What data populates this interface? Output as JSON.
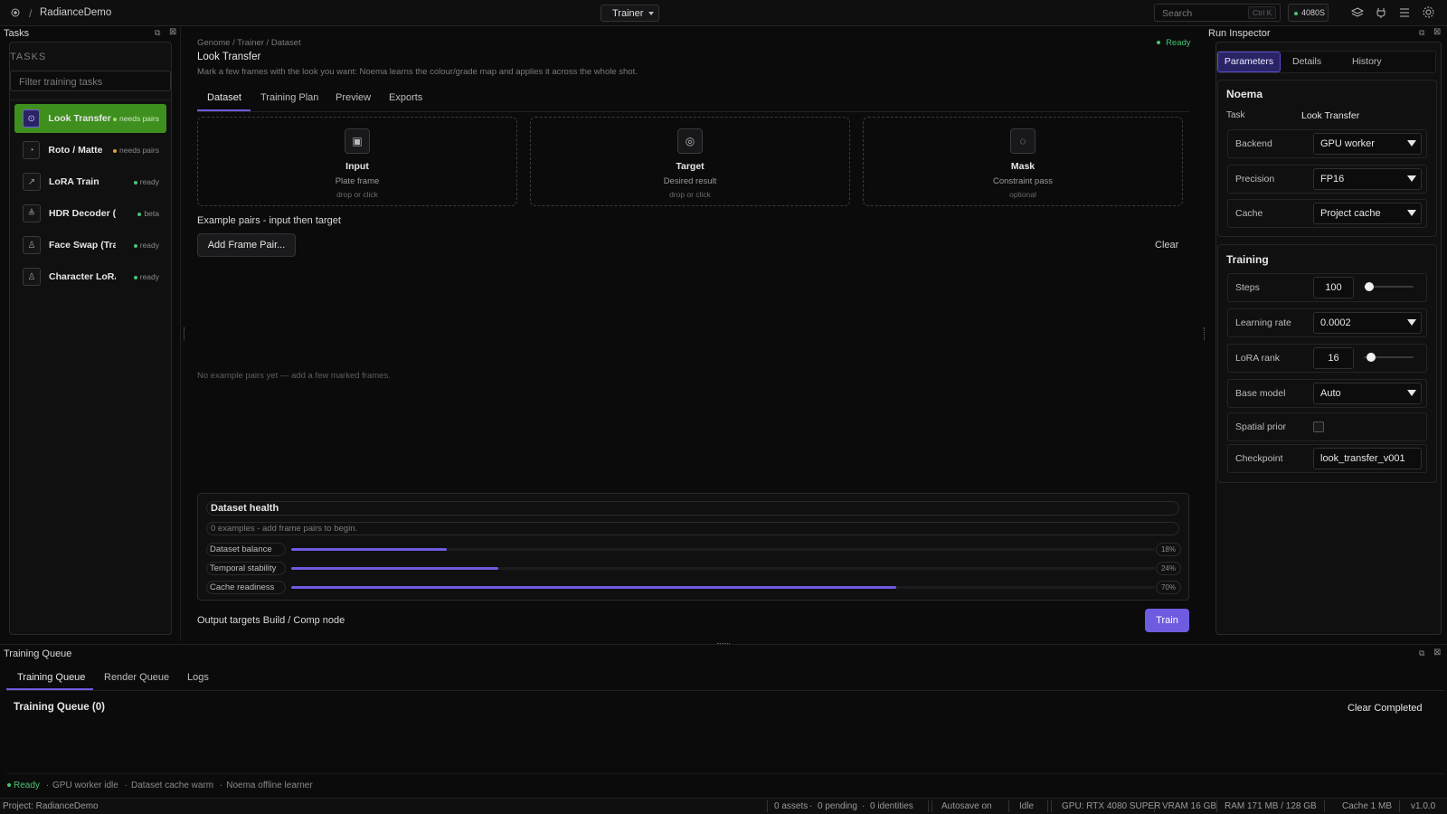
{
  "app": {
    "breadcrumb_sep": "/",
    "project_name": "RadianceDemo",
    "mode": "Trainer",
    "search_placeholder": "Search",
    "search_shortcut": "Ctrl K",
    "gpu_badge": "4080S"
  },
  "tasks_panel": {
    "title": "Tasks",
    "heading": "TASKS",
    "filter_placeholder": "Filter training tasks",
    "items": [
      {
        "label": "Look Transfer",
        "status": "needs pairs",
        "icon": "target-icon",
        "glyph": "⊙",
        "status_color": "#9be37a"
      },
      {
        "label": "Roto / Matte",
        "status": "needs pairs",
        "icon": "dial-icon",
        "glyph": "◔",
        "status_color": "#e0a040"
      },
      {
        "label": "LoRA Train",
        "status": "ready",
        "icon": "trend-icon",
        "glyph": "↗",
        "status_color": "#46c46e"
      },
      {
        "label": "HDR Decoder (RUD",
        "status": "beta",
        "icon": "layers-icon",
        "glyph": "≜",
        "status_color": "#46c46e"
      },
      {
        "label": "Face Swap (Train)",
        "status": "ready",
        "icon": "person-icon",
        "glyph": "♙",
        "status_color": "#46c46e"
      },
      {
        "label": "Character LoRA (Tr",
        "status": "ready",
        "icon": "person-icon",
        "glyph": "♙",
        "status_color": "#46c46e"
      }
    ]
  },
  "main": {
    "breadcrumb": "Genome / Trainer / Dataset",
    "status": "Ready",
    "title": "Look Transfer",
    "description": "Mark a few frames with the look you want: Noema learns the colour/grade map and applies it across the whole shot.",
    "tabs": [
      "Dataset",
      "Training Plan",
      "Preview",
      "Exports"
    ],
    "drops": [
      {
        "title": "Input",
        "subtitle": "Plate frame",
        "hint": "drop or click",
        "icon": "image-icon",
        "glyph": "▣"
      },
      {
        "title": "Target",
        "subtitle": "Desired result",
        "hint": "drop or click",
        "icon": "target-icon",
        "glyph": "◎"
      },
      {
        "title": "Mask",
        "subtitle": "Constraint pass",
        "hint": "optional",
        "icon": "dial-icon",
        "glyph": "◌"
      }
    ],
    "pairs_heading": "Example pairs - input then target",
    "add_pair_label": "Add Frame Pair...",
    "clear_label": "Clear",
    "empty_text": "No example pairs yet — add a few marked frames.",
    "health": {
      "title": "Dataset health",
      "summary": "0 examples - add frame pairs to begin.",
      "metrics": [
        {
          "label": "Dataset balance",
          "value": 0.18,
          "pct": "18%"
        },
        {
          "label": "Temporal stability",
          "value": 0.24,
          "pct": "24%"
        },
        {
          "label": "Cache readiness",
          "value": 0.7,
          "pct": "70%"
        }
      ]
    },
    "output_text": "Output targets Build / Comp node",
    "train_label": "Train"
  },
  "inspector": {
    "title": "Run Inspector",
    "tabs": [
      "Parameters",
      "Details",
      "History"
    ],
    "engine": "Noema",
    "task_label": "Task",
    "task_value": "Look Transfer",
    "backend_label": "Backend",
    "backend_value": "GPU worker",
    "precision_label": "Precision",
    "precision_value": "FP16",
    "cache_label": "Cache",
    "cache_value": "Project cache",
    "training_heading": "Training",
    "steps_label": "Steps",
    "steps_value": "100",
    "steps_level": 0.02,
    "lr_label": "Learning rate",
    "lr_value": "0.0002",
    "rank_label": "LoRA rank",
    "rank_value": "16",
    "rank_level": 0.06,
    "base_label": "Base model",
    "base_value": "Auto",
    "spatial_label": "Spatial prior",
    "checkpoint_label": "Checkpoint",
    "checkpoint_value": "look_transfer_v001"
  },
  "queue": {
    "title": "Training Queue",
    "tabs": [
      "Training Queue",
      "Render Queue",
      "Logs"
    ],
    "heading": "Training Queue (0)",
    "clear_completed": "Clear Completed",
    "status_items": [
      "Ready",
      "GPU worker idle",
      "Dataset cache warm",
      "Noema offline learner"
    ],
    "status_sep": "·"
  },
  "statusbar": {
    "project": "Project: RadianceDemo",
    "assets": "0 assets",
    "pending": "0 pending",
    "identities": "0 identities",
    "autosave": "Autosave on",
    "idle": "Idle",
    "gpu": "GPU: RTX 4080 SUPER",
    "vram": "VRAM 16 GB",
    "ram": "RAM 171 MB / 128 GB",
    "cache": "Cache 1 MB",
    "version": "v1.0.0"
  },
  "colors": {
    "accent": "#6e5ce0",
    "active_task": "#3f8f1f",
    "ready_green": "#46c46e"
  }
}
